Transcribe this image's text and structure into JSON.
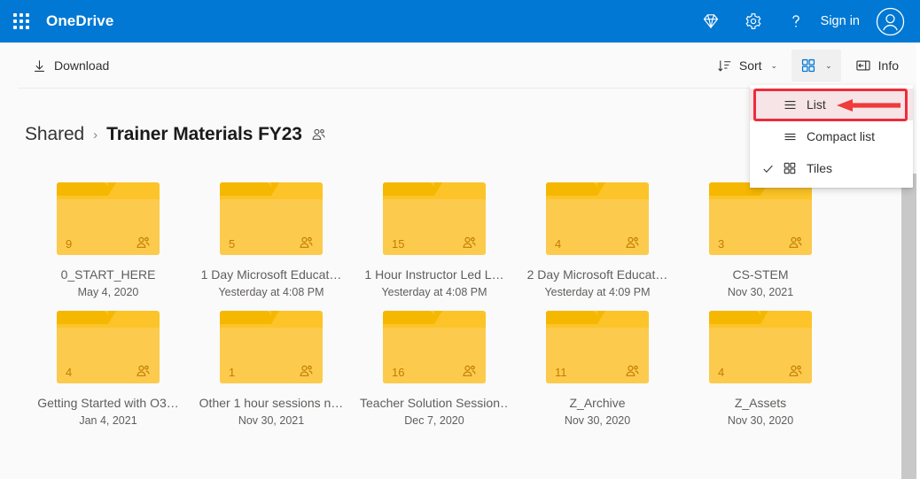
{
  "suite": {
    "app_launcher_icon": "waffle-grid-icon",
    "title": "OneDrive",
    "diamond_icon": "diamond-icon",
    "settings_icon": "gear-icon",
    "help_icon": "question-mark-icon",
    "signin_label": "Sign in",
    "avatar_icon": "person-avatar-icon",
    "brand_color": "#0078d4"
  },
  "command_bar": {
    "download": {
      "label": "Download",
      "icon": "download-arrow-icon"
    },
    "sort": {
      "label": "Sort",
      "icon": "sort-descending-icon",
      "chevron": "⌄"
    },
    "view": {
      "icon": "tiles-grid-icon",
      "chevron": "⌄",
      "pressed": true
    },
    "info": {
      "label": "Info",
      "icon": "info-pane-icon"
    }
  },
  "view_menu": {
    "items": [
      {
        "label": "List",
        "icon": "list-view-icon",
        "checked": false,
        "highlighted": true
      },
      {
        "label": "Compact list",
        "icon": "compact-list-icon",
        "checked": false,
        "highlighted": false
      },
      {
        "label": "Tiles",
        "icon": "tiles-grid-icon",
        "checked": true,
        "highlighted": false
      }
    ],
    "checkmark": "✓",
    "highlight_color": "#ee2b3b",
    "arrow_icon": "red-pointer-arrow"
  },
  "breadcrumb": {
    "root": "Shared",
    "separator": "›",
    "current": "Trainer Materials FY23",
    "shared_icon": "people-shared-icon"
  },
  "files": {
    "rows": [
      [
        {
          "name": "0_START_HERE",
          "date": "May 4, 2020",
          "count": "9",
          "shared": true,
          "icon": "folder-icon"
        },
        {
          "name": "1 Day Microsoft Educat…",
          "date": "Yesterday at 4:08 PM",
          "count": "5",
          "shared": true,
          "icon": "folder-icon"
        },
        {
          "name": "1 Hour Instructor Led L…",
          "date": "Yesterday at 4:08 PM",
          "count": "15",
          "shared": true,
          "icon": "folder-icon"
        },
        {
          "name": "2 Day Microsoft Educat…",
          "date": "Yesterday at 4:09 PM",
          "count": "4",
          "shared": true,
          "icon": "folder-icon"
        },
        {
          "name": "CS-STEM",
          "date": "Nov 30, 2021",
          "count": "3",
          "shared": true,
          "icon": "folder-icon"
        }
      ],
      [
        {
          "name": "Getting Started with O3…",
          "date": "Jan 4, 2021",
          "count": "4",
          "shared": true,
          "icon": "folder-icon"
        },
        {
          "name": "Other 1 hour sessions n…",
          "date": "Nov 30, 2021",
          "count": "1",
          "shared": true,
          "icon": "folder-icon"
        },
        {
          "name": "Teacher Solution Session…",
          "date": "Dec 7, 2020",
          "count": "16",
          "shared": true,
          "icon": "folder-icon"
        },
        {
          "name": "Z_Archive",
          "date": "Nov 30, 2020",
          "count": "11",
          "shared": true,
          "icon": "folder-icon"
        },
        {
          "name": "Z_Assets",
          "date": "Nov 30, 2020",
          "count": "4",
          "shared": true,
          "icon": "folder-icon"
        }
      ]
    ]
  },
  "scrollbar": {
    "name": "vertical-scrollbar"
  }
}
